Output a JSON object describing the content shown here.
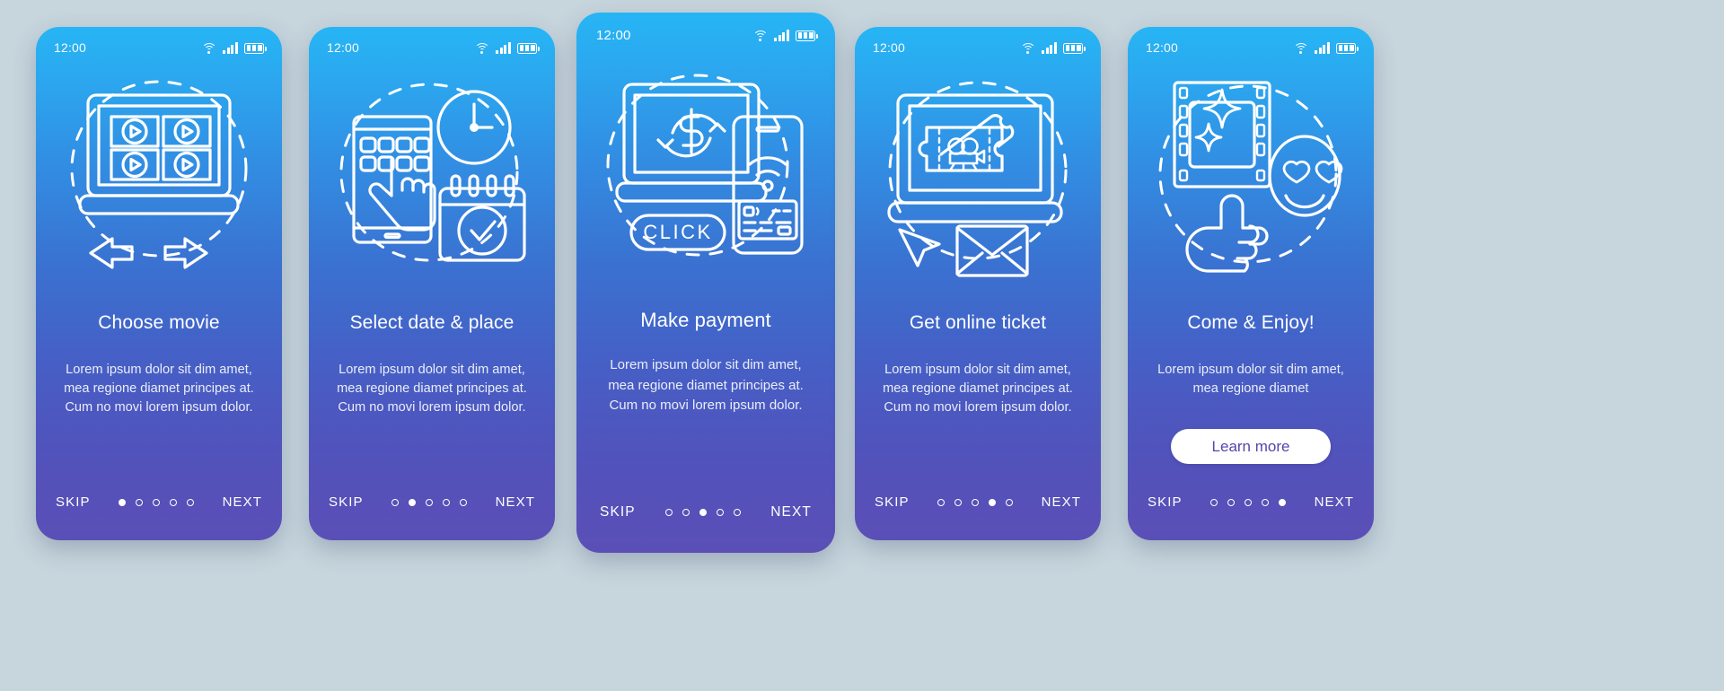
{
  "background_color": "#c7d5dd",
  "card_gradient": {
    "from": "#26b5f5",
    "mid": "#3a72d1",
    "to": "#5b4fb6"
  },
  "status_bar": {
    "time": "12:00",
    "icons": [
      "wifi-icon",
      "cellular-signal-icon",
      "battery-icon"
    ]
  },
  "common": {
    "skip_label": "SKIP",
    "next_label": "NEXT",
    "dot_count": 5
  },
  "screens": [
    {
      "id": "choose-movie",
      "icon": "laptop-movie-grid-icon",
      "title": "Choose movie",
      "body": "Lorem ipsum dolor sit dim amet, mea regione diamet principes at. Cum no movi lorem ipsum dolor.",
      "active_dot": 1
    },
    {
      "id": "select-date-place",
      "icon": "phone-seats-clock-calendar-icon",
      "title": "Select date & place",
      "body": "Lorem ipsum dolor sit dim amet, mea regione diamet principes at. Cum no movi lorem ipsum dolor.",
      "active_dot": 2
    },
    {
      "id": "make-payment",
      "icon": "laptop-dollar-phone-card-click-icon",
      "title": "Make payment",
      "body": "Lorem ipsum dolor sit dim amet, mea regione diamet principes at. Cum no movi lorem ipsum dolor.",
      "active_dot": 3
    },
    {
      "id": "get-online-ticket",
      "icon": "laptop-tickets-cursor-envelope-icon",
      "title": "Get online ticket",
      "body": "Lorem ipsum dolor sit dim amet, mea regione diamet principes at. Cum no movi lorem ipsum dolor.",
      "active_dot": 4
    },
    {
      "id": "come-and-enjoy",
      "icon": "filmstrip-smiley-thumbsup-icon",
      "title": "Come & Enjoy!",
      "body": "Lorem ipsum dolor sit dim amet, mea regione diamet",
      "cta_label": "Learn more",
      "cta_text_color": "#5346ad",
      "active_dot": 5
    }
  ]
}
